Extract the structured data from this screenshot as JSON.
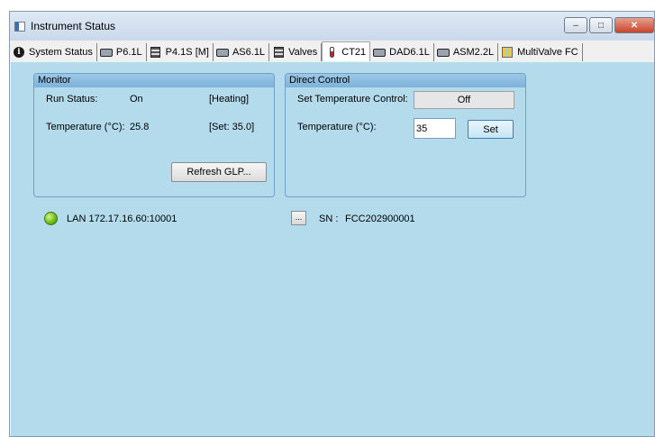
{
  "window": {
    "title": "Instrument Status",
    "minimize": "–",
    "maximize": "□",
    "close": "✕"
  },
  "tabs": [
    {
      "label": "System Status",
      "icon": "info-icon"
    },
    {
      "label": "P6.1L",
      "icon": "pump-icon"
    },
    {
      "label": "P4.1S [M]",
      "icon": "module-icon"
    },
    {
      "label": "AS6.1L",
      "icon": "autosampler-icon"
    },
    {
      "label": "Valves",
      "icon": "valve-icon"
    },
    {
      "label": "CT21",
      "icon": "thermometer-icon",
      "active": true
    },
    {
      "label": "DAD6.1L",
      "icon": "detector-icon"
    },
    {
      "label": "ASM2.2L",
      "icon": "pump-icon"
    },
    {
      "label": "MultiValve FC",
      "icon": "multivalve-icon"
    }
  ],
  "monitor": {
    "title": "Monitor",
    "run_status_label": "Run Status:",
    "run_status_value": "On",
    "run_status_state": "[Heating]",
    "temperature_label": "Temperature (°C):",
    "temperature_value": "25.8",
    "temperature_set": "[Set: 35.0]",
    "refresh_button": "Refresh GLP..."
  },
  "direct_control": {
    "title": "Direct Control",
    "set_temp_control_label": "Set Temperature Control:",
    "set_temp_control_value": "Off",
    "temperature_label": "Temperature (°C):",
    "temperature_input": "35",
    "set_button": "Set"
  },
  "connection": {
    "status_color": "#6cc01a",
    "lan_text": "LAN 172.17.16.60:10001",
    "more_button": "...",
    "serial_label": "SN :",
    "serial_value": "FCC202900001"
  },
  "colors": {
    "content_bg": "#b3dbeb",
    "group_header": "#7eb2da"
  }
}
